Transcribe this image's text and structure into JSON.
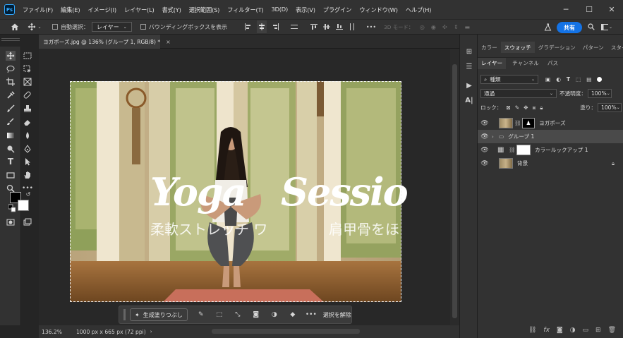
{
  "app": {
    "logo": "Ps",
    "menu": [
      "ファイル(F)",
      "編集(E)",
      "イメージ(I)",
      "レイヤー(L)",
      "書式(Y)",
      "選択範囲(S)",
      "フィルター(T)",
      "3D(D)",
      "表示(V)",
      "プラグイン",
      "ウィンドウ(W)",
      "ヘルプ(H)"
    ],
    "window_controls": [
      "─",
      "☐",
      "✕"
    ]
  },
  "options_bar": {
    "auto_select_label": "自動選択：",
    "auto_select_target": "レイヤー",
    "bounding_box_label": "バウンディングボックスを表示",
    "mode_3d_label": "3D モード：",
    "share_label": "共有",
    "more_label": "•••"
  },
  "document": {
    "tab_title": "ヨガポーズ.jpg @ 136% (グループ 1, RGB/8) *",
    "tab_close": "×",
    "zoom": "136.2%",
    "doc_info": "1000 px x 665 px (72 ppi)",
    "text_script_left": "Yoga",
    "text_script_right": "Sessio",
    "text_jp_left": "柔軟ストレッチ ワ",
    "text_jp_right": "肩甲骨をほ"
  },
  "contextual_taskbar": {
    "generative_fill": "生成塗りつぶし",
    "more": "•••",
    "deselect": "選択を解除"
  },
  "panels": {
    "tabs_top": [
      "カラー",
      "スウォッチ",
      "グラデーション",
      "パターン",
      "スタイル"
    ],
    "active_top_tab": "スウォッチ",
    "tabs_layers": [
      "レイヤー",
      "チャンネル",
      "パス"
    ],
    "filter_kind": "種類",
    "blend_mode": "通過",
    "opacity_label": "不透明度：",
    "opacity_value": "100%",
    "lock_label": "ロック：",
    "fill_label": "塗り：",
    "fill_value": "100%",
    "layers": [
      {
        "name": "ヨガポーズ",
        "type": "image-with-mask"
      },
      {
        "name": "グループ 1",
        "type": "group",
        "selected": true
      },
      {
        "name": "カラールックアップ 1",
        "type": "adjustment"
      },
      {
        "name": "背景",
        "type": "background",
        "locked": true
      }
    ]
  },
  "colors": {
    "accent": "#1473e6",
    "ps_blue": "#31a8ff",
    "panel_bg": "#323232",
    "canvas_bg": "#282828"
  }
}
